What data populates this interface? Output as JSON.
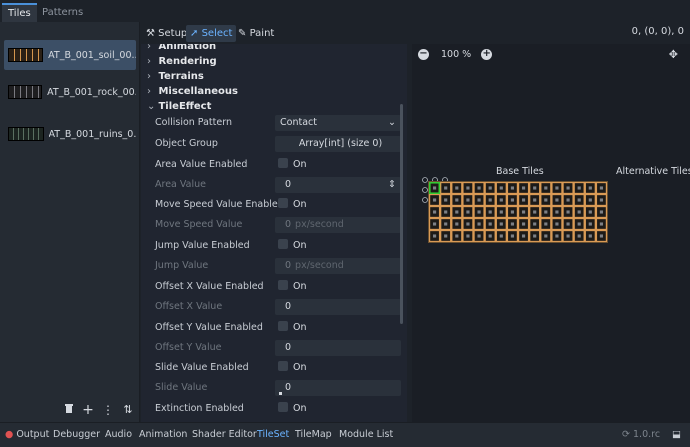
{
  "top_tabs": [
    {
      "label": "Tiles",
      "active": true
    },
    {
      "label": "Patterns",
      "active": false
    }
  ],
  "sources": [
    {
      "name": "AT_B_001_soil_00....",
      "selected": true
    },
    {
      "name": "AT_B_001_rock_00....",
      "selected": false
    },
    {
      "name": "AT_B_001_ruins_0...",
      "selected": false
    }
  ],
  "left_toolbar_icons": [
    "trash-icon",
    "plus-icon",
    "kebab-menu-icon",
    "sort-icon"
  ],
  "toolbar": {
    "setup": "Setup",
    "select": "Select",
    "paint": "Paint",
    "coords": "0, (0, 0), 0"
  },
  "inspector": {
    "sections": [
      "Animation",
      "Rendering",
      "Terrains",
      "Miscellaneous",
      "TileEffect"
    ],
    "properties": [
      {
        "label": "Collision Pattern",
        "value": "Contact",
        "kind": "dropdown",
        "dim": false
      },
      {
        "label": "Object Group",
        "value": "Array[int] (size 0)",
        "kind": "button",
        "dim": false
      },
      {
        "label": "Area Value Enabled",
        "value": "On",
        "kind": "check",
        "dim": false
      },
      {
        "label": "Area Value",
        "value": "0",
        "kind": "spin",
        "dim": true
      },
      {
        "label": "Move Speed Value Enabled",
        "value": "On",
        "kind": "check",
        "dim": false
      },
      {
        "label": "Move Speed Value",
        "value": "0",
        "unit": "px/second",
        "kind": "number",
        "dim": true
      },
      {
        "label": "Jump Value Enabled",
        "value": "On",
        "kind": "check",
        "dim": false
      },
      {
        "label": "Jump Value",
        "value": "0",
        "unit": "px/second",
        "kind": "number",
        "dim": true
      },
      {
        "label": "Offset X Value Enabled",
        "value": "On",
        "kind": "check",
        "dim": false
      },
      {
        "label": "Offset X Value",
        "value": "0",
        "kind": "number",
        "dim": true
      },
      {
        "label": "Offset Y Value Enabled",
        "value": "On",
        "kind": "check",
        "dim": false
      },
      {
        "label": "Offset Y Value",
        "value": "0",
        "kind": "number",
        "dim": true
      },
      {
        "label": "Slide Value Enabled",
        "value": "On",
        "kind": "check",
        "dim": false
      },
      {
        "label": "Slide Value",
        "value": "0",
        "kind": "slider",
        "dim": true
      },
      {
        "label": "Extinction Enabled",
        "value": "On",
        "kind": "check",
        "dim": false
      }
    ]
  },
  "preview": {
    "zoom": "100 %",
    "base_tiles_label": "Base Tiles",
    "alternative_tiles_label": "Alternative Tiles",
    "atlas_columns": 16,
    "atlas_rows": 5
  },
  "statusbar": {
    "items": [
      {
        "label": "Output",
        "active": false
      },
      {
        "label": "Debugger",
        "active": false
      },
      {
        "label": "Audio",
        "active": false
      },
      {
        "label": "Animation",
        "active": false
      },
      {
        "label": "Shader Editor",
        "active": false
      },
      {
        "label": "TileSet",
        "active": true
      },
      {
        "label": "TileMap",
        "active": false
      },
      {
        "label": "Module List",
        "active": false
      }
    ],
    "version": "1.0.rc"
  },
  "colors": {
    "accent": "#6bb3ff",
    "tile_fill": "#1c1a18",
    "tile_border": "#d99a55",
    "selected_tile": "#33cc33"
  }
}
